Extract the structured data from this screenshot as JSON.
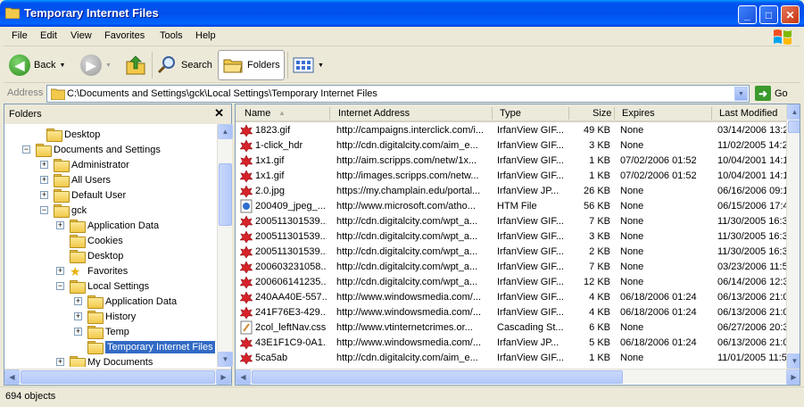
{
  "window": {
    "title": "Temporary Internet Files",
    "minimize_glyph": "_",
    "maximize_glyph": "□",
    "close_glyph": "✕"
  },
  "menu": [
    "File",
    "Edit",
    "View",
    "Favorites",
    "Tools",
    "Help"
  ],
  "toolbar": {
    "back_label": "Back",
    "search_label": "Search",
    "folders_label": "Folders"
  },
  "address": {
    "label": "Address",
    "path": "C:\\Documents and Settings\\gck\\Local Settings\\Temporary Internet Files",
    "go_label": "Go"
  },
  "folders": {
    "title": "Folders",
    "close_glyph": "✕",
    "tree": [
      {
        "label": "Desktop",
        "expander": ""
      },
      {
        "label": "Documents and Settings",
        "expander": "−"
      },
      {
        "label": "Administrator",
        "expander": "+"
      },
      {
        "label": "All Users",
        "expander": "+"
      },
      {
        "label": "Default User",
        "expander": "+"
      },
      {
        "label": "gck",
        "expander": "−"
      },
      {
        "label": "Application Data",
        "expander": "+"
      },
      {
        "label": "Cookies",
        "expander": ""
      },
      {
        "label": "Desktop",
        "expander": ""
      },
      {
        "label": "Favorites",
        "expander": "+"
      },
      {
        "label": "Local Settings",
        "expander": "−"
      },
      {
        "label": "Application Data",
        "expander": "+"
      },
      {
        "label": "History",
        "expander": "+"
      },
      {
        "label": "Temp",
        "expander": "+"
      },
      {
        "label": "Temporary Internet Files",
        "expander": "",
        "selected": true
      },
      {
        "label": "My Documents",
        "expander": "+"
      }
    ]
  },
  "columns": [
    "Name",
    "Internet Address",
    "Type",
    "Size",
    "Expires",
    "Last Modified"
  ],
  "files": [
    {
      "name": "1823.gif",
      "address": "http://campaigns.interclick.com/i...",
      "type": "IrfanView GIF...",
      "size": "49 KB",
      "expires": "None",
      "modified": "03/14/2006 13:2",
      "icon": "irfan"
    },
    {
      "name": "1-click_hdr",
      "address": "http://cdn.digitalcity.com/aim_e...",
      "type": "IrfanView GIF...",
      "size": "3 KB",
      "expires": "None",
      "modified": "11/02/2005 14:2",
      "icon": "irfan"
    },
    {
      "name": "1x1.gif",
      "address": "http://aim.scripps.com/netw/1x...",
      "type": "IrfanView GIF...",
      "size": "1 KB",
      "expires": "07/02/2006 01:52",
      "modified": "10/04/2001 14:1",
      "icon": "irfan"
    },
    {
      "name": "1x1.gif",
      "address": "http://images.scripps.com/netw...",
      "type": "IrfanView GIF...",
      "size": "1 KB",
      "expires": "07/02/2006 01:52",
      "modified": "10/04/2001 14:1",
      "icon": "irfan"
    },
    {
      "name": "2.0.jpg",
      "address": "https://my.champlain.edu/portal...",
      "type": "IrfanView JP...",
      "size": "26 KB",
      "expires": "None",
      "modified": "06/16/2006 09:1",
      "icon": "irfan"
    },
    {
      "name": "200409_jpeg_...",
      "address": "http://www.microsoft.com/atho...",
      "type": "HTM File",
      "size": "56 KB",
      "expires": "None",
      "modified": "06/15/2006 17:4",
      "icon": "htm"
    },
    {
      "name": "200511301539...",
      "address": "http://cdn.digitalcity.com/wpt_a...",
      "type": "IrfanView GIF...",
      "size": "7 KB",
      "expires": "None",
      "modified": "11/30/2005 16:3",
      "icon": "irfan"
    },
    {
      "name": "200511301539...",
      "address": "http://cdn.digitalcity.com/wpt_a...",
      "type": "IrfanView GIF...",
      "size": "3 KB",
      "expires": "None",
      "modified": "11/30/2005 16:3",
      "icon": "irfan"
    },
    {
      "name": "200511301539...",
      "address": "http://cdn.digitalcity.com/wpt_a...",
      "type": "IrfanView GIF...",
      "size": "2 KB",
      "expires": "None",
      "modified": "11/30/2005 16:3",
      "icon": "irfan"
    },
    {
      "name": "200603231058...",
      "address": "http://cdn.digitalcity.com/wpt_a...",
      "type": "IrfanView GIF...",
      "size": "7 KB",
      "expires": "None",
      "modified": "03/23/2006 11:5",
      "icon": "irfan"
    },
    {
      "name": "200606141235...",
      "address": "http://cdn.digitalcity.com/wpt_a...",
      "type": "IrfanView GIF...",
      "size": "12 KB",
      "expires": "None",
      "modified": "06/14/2006 12:3",
      "icon": "irfan"
    },
    {
      "name": "240AA40E-557...",
      "address": "http://www.windowsmedia.com/...",
      "type": "IrfanView GIF...",
      "size": "4 KB",
      "expires": "06/18/2006 01:24",
      "modified": "06/13/2006 21:0",
      "icon": "irfan"
    },
    {
      "name": "241F76E3-429...",
      "address": "http://www.windowsmedia.com/...",
      "type": "IrfanView GIF...",
      "size": "4 KB",
      "expires": "06/18/2006 01:24",
      "modified": "06/13/2006 21:0",
      "icon": "irfan"
    },
    {
      "name": "2col_leftNav.css",
      "address": "http://www.vtinternetcrimes.or...",
      "type": "Cascading St...",
      "size": "6 KB",
      "expires": "None",
      "modified": "06/27/2006 20:3",
      "icon": "css"
    },
    {
      "name": "43E1F1C9-0A1...",
      "address": "http://www.windowsmedia.com/...",
      "type": "IrfanView JP...",
      "size": "5 KB",
      "expires": "06/18/2006 01:24",
      "modified": "06/13/2006 21:0",
      "icon": "irfan"
    },
    {
      "name": "5ca5ab",
      "address": "http://cdn.digitalcity.com/aim_e...",
      "type": "IrfanView GIF...",
      "size": "1 KB",
      "expires": "None",
      "modified": "11/01/2005 11:5",
      "icon": "irfan"
    }
  ],
  "status": {
    "text": "694 objects"
  }
}
